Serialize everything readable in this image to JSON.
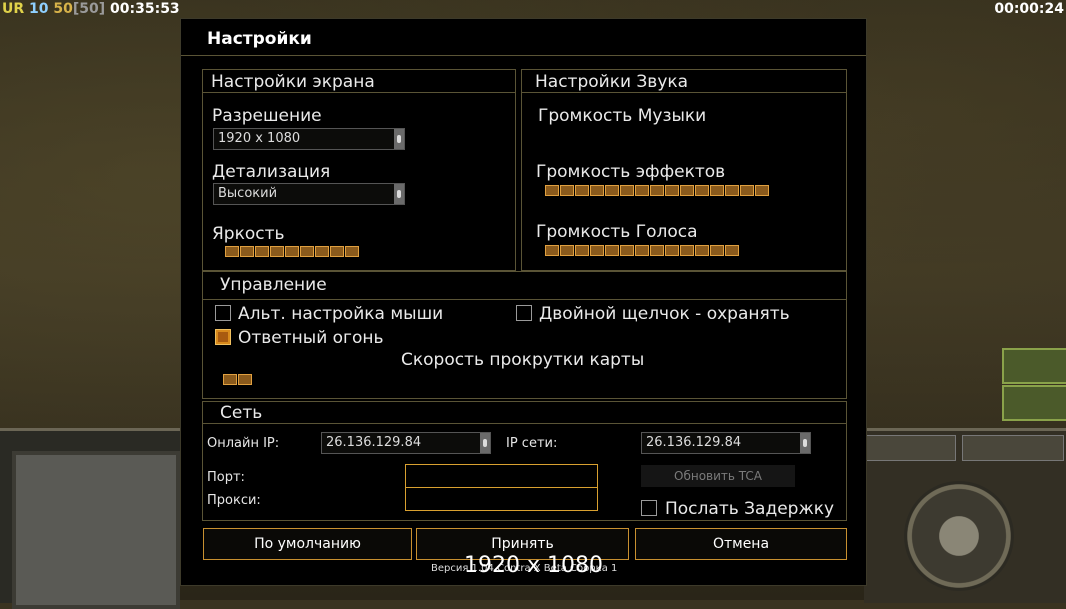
{
  "hud": {
    "ur": "UR",
    "n1": "10",
    "n2": "50",
    "n3": "[50]",
    "time_left": "00:35:53",
    "time_right": "00:00:24"
  },
  "dialog": {
    "title": "Настройки",
    "screen": {
      "heading": "Настройки экрана",
      "resolution_label": "Разрешение",
      "resolution_value": "1920 x 1080",
      "detail_label": "Детализация",
      "detail_value": "Высокий",
      "brightness_label": "Яркость",
      "brightness_segments": 9
    },
    "sound": {
      "heading": "Настройки Звука",
      "music_label": "Громкость Музыки",
      "effects_label": "Громкость эффектов",
      "effects_segments": 15,
      "voice_label": "Громкость Голоса",
      "voice_segments": 13
    },
    "control": {
      "heading": "Управление",
      "alt_mouse": "Альт. настройка мыши",
      "alt_mouse_checked": false,
      "double_click": "Двойной щелчок - охранять",
      "double_click_checked": false,
      "return_fire": "Ответный огонь",
      "return_fire_checked": true,
      "scroll_speed_label": "Скорость прокрутки карты",
      "scroll_segments": 2
    },
    "network": {
      "heading": "Сеть",
      "online_ip_label": "Онлайн IP:",
      "online_ip_value": "26.136.129.84",
      "lan_ip_label": "IP сети:",
      "lan_ip_value": "26.136.129.84",
      "port_label": "Порт:",
      "proxy_label": "Прокси:",
      "update_tca": "Обновить TCA",
      "send_delay": "Послать Задержку",
      "send_delay_checked": false
    },
    "buttons": {
      "default": "По умолчанию",
      "accept": "Принять",
      "cancel": "Отмена"
    },
    "version": "Версия 1.04 Contra X Beta Сборка 1",
    "overlay_resolution": "1920 x 1080"
  }
}
